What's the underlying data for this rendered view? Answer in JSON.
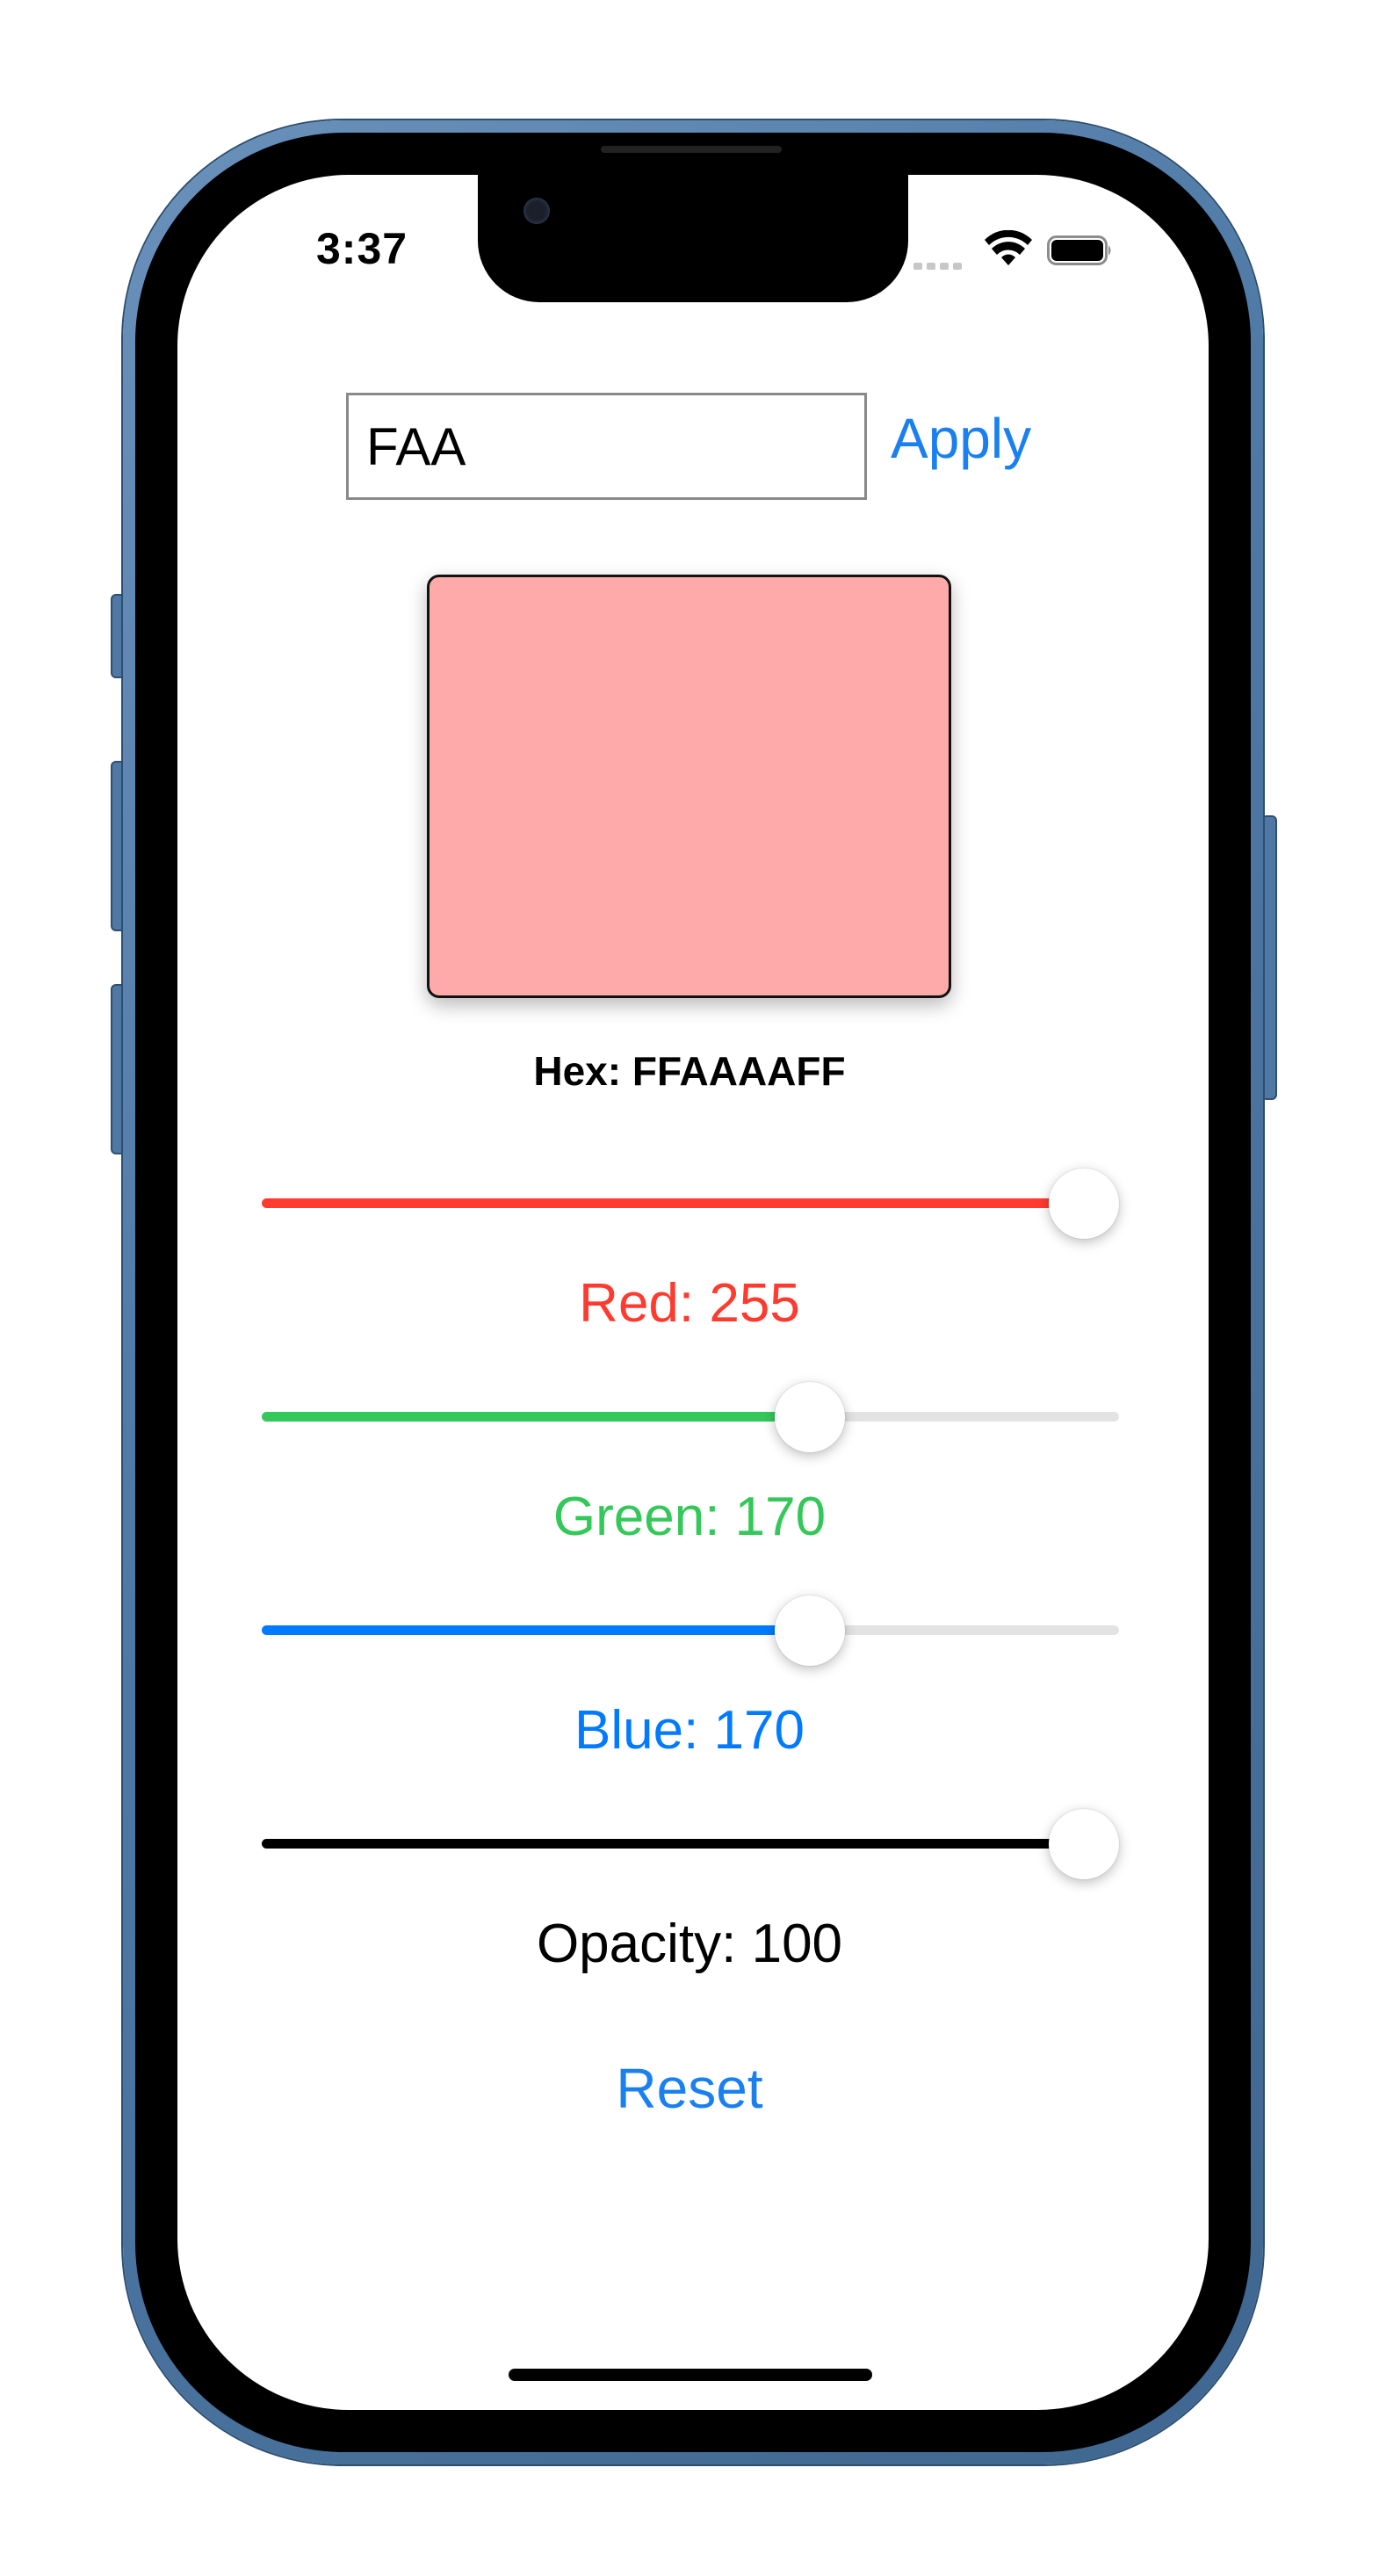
{
  "status_bar": {
    "time": "3:37"
  },
  "hex_input": {
    "value": "FAA",
    "placeholder": ""
  },
  "apply_label": "Apply",
  "preview": {
    "color": "#FFAAAA"
  },
  "hex_readout": "Hex: FFAAAAFF",
  "sliders": [
    {
      "id": "red",
      "label": "Red: 255",
      "value": 255,
      "max": 255,
      "color": "#FF3B30"
    },
    {
      "id": "green",
      "label": "Green: 170",
      "value": 170,
      "max": 255,
      "color": "#34C759"
    },
    {
      "id": "blue",
      "label": "Blue: 170",
      "value": 170,
      "max": 255,
      "color": "#007AFF"
    },
    {
      "id": "opacity",
      "label": "Opacity: 100",
      "value": 100,
      "max": 100,
      "color": "#000000"
    }
  ],
  "reset_label": "Reset",
  "icons": {
    "signal": "cellular-signal-icon",
    "wifi": "wifi-icon",
    "battery": "battery-icon"
  }
}
